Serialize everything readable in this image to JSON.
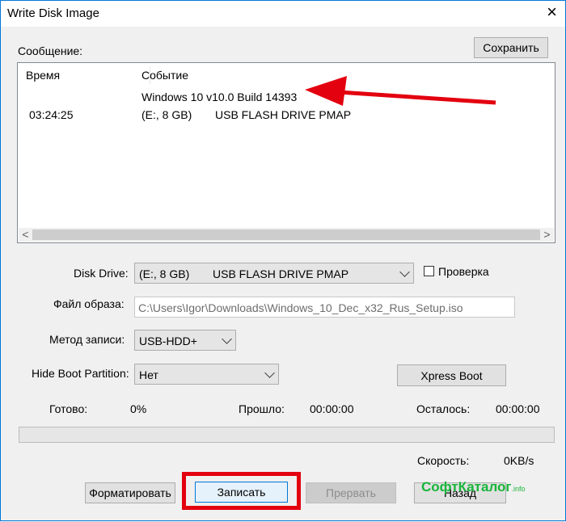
{
  "window": {
    "title": "Write Disk Image",
    "close_glyph": "×"
  },
  "messages": {
    "label": "Сообщение:",
    "save_button": "Сохранить",
    "columns": [
      "Время",
      "Событие"
    ],
    "rows": [
      {
        "time": "",
        "event": "Windows 10 v10.0 Build 14393",
        "detail": ""
      },
      {
        "time": "03:24:25",
        "event": "(E:, 8 GB)",
        "detail": "USB FLASH DRIVE PMAP"
      }
    ],
    "scroll_left": "<",
    "scroll_right": ">"
  },
  "form": {
    "disk_drive_label": "Disk Drive:",
    "disk_drive_value": "(E:, 8 GB)",
    "disk_drive_device": "USB FLASH DRIVE PMAP",
    "verify_label": "Проверка",
    "verify_checked": false,
    "image_file_label": "Файл образа:",
    "image_file_value": "C:\\Users\\Igor\\Downloads\\Windows_10_Dec_x32_Rus_Setup.iso",
    "write_method_label": "Метод записи:",
    "write_method_value": "USB-HDD+",
    "hide_boot_label": "Hide Boot Partition:",
    "hide_boot_value": "Нет",
    "xpress_boot_button": "Xpress Boot"
  },
  "status": {
    "done_label": "Готово:",
    "done_value": "0%",
    "progress_fraction": 0,
    "elapsed_label": "Прошло:",
    "elapsed_value": "00:00:00",
    "remaining_label": "Осталось:",
    "remaining_value": "00:00:00",
    "speed_label": "Скорость:",
    "speed_value": "0KB/s"
  },
  "buttons": {
    "format": "Форматировать",
    "write": "Записать",
    "abort": "Прервать",
    "back": "Назад"
  },
  "watermark": {
    "text": "СофтКаталог",
    "suffix": ".info"
  },
  "colors": {
    "highlight": "#e3000f",
    "accent": "#0078d7",
    "watermark": "#17b53a"
  }
}
